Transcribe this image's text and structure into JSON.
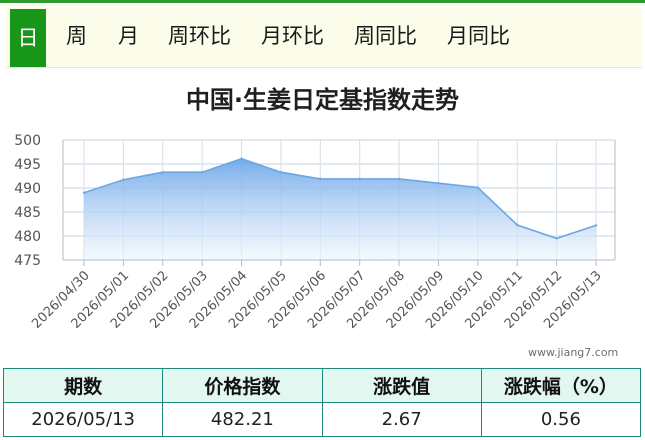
{
  "tabs": [
    {
      "label": "日",
      "active": true
    },
    {
      "label": "周"
    },
    {
      "label": "月"
    },
    {
      "label": "周环比"
    },
    {
      "label": "月环比"
    },
    {
      "label": "周同比"
    },
    {
      "label": "月同比"
    }
  ],
  "watermark": "www.jiang7.com",
  "table": {
    "headers": [
      "期数",
      "价格指数",
      "涨跌值",
      "涨跌幅（%）"
    ],
    "row": [
      "2026/05/13",
      "482.21",
      "2.67",
      "0.56"
    ]
  },
  "colors": {
    "accent": "#17961a",
    "line": "#6aa7e4",
    "area_top": "#7fb3ea",
    "table_border": "#1c8a76",
    "table_header_bg": "#e3f7f1"
  },
  "chart_data": {
    "type": "area",
    "title": "中国·生姜日定基指数走势",
    "xlabel": "",
    "ylabel": "",
    "categories": [
      "2026/04/30",
      "2026/05/01",
      "2026/05/02",
      "2026/05/03",
      "2026/05/04",
      "2026/05/05",
      "2026/05/06",
      "2026/05/07",
      "2026/05/08",
      "2026/05/09",
      "2026/05/10",
      "2026/05/11",
      "2026/05/12",
      "2026/05/13"
    ],
    "series": [
      {
        "values": [
          489.0,
          491.7,
          493.3,
          493.3,
          496.1,
          493.3,
          491.9,
          491.9,
          491.9,
          491.0,
          490.1,
          482.3,
          479.5,
          482.21
        ]
      }
    ],
    "yticks": [
      475,
      480,
      485,
      490,
      495,
      500
    ],
    "ylim": [
      475,
      500
    ],
    "grid": true
  }
}
